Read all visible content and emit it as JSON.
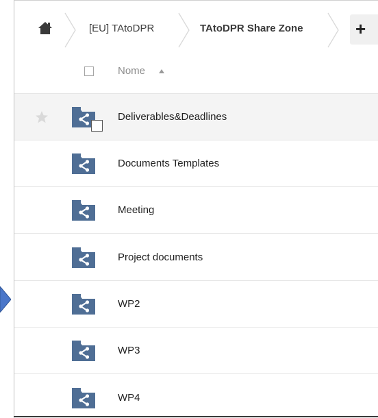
{
  "colors": {
    "folder": "#4f6e95",
    "nav_arrow": "#4a76c9",
    "row_hover": "#f4f4f4"
  },
  "breadcrumb": {
    "home_icon": "home-icon",
    "items": [
      {
        "label": "[EU] TAtoDPR"
      },
      {
        "label": "TAtoDPR Share Zone"
      }
    ],
    "add_label": "+"
  },
  "header": {
    "name_label": "Nome",
    "sort_icon": "sort-ascending-icon"
  },
  "rows": [
    {
      "name": "Deliverables&Deadlines"
    },
    {
      "name": "Documents Templates"
    },
    {
      "name": "Meeting"
    },
    {
      "name": "Project documents"
    },
    {
      "name": "WP2"
    },
    {
      "name": "WP3"
    },
    {
      "name": "WP4"
    }
  ]
}
